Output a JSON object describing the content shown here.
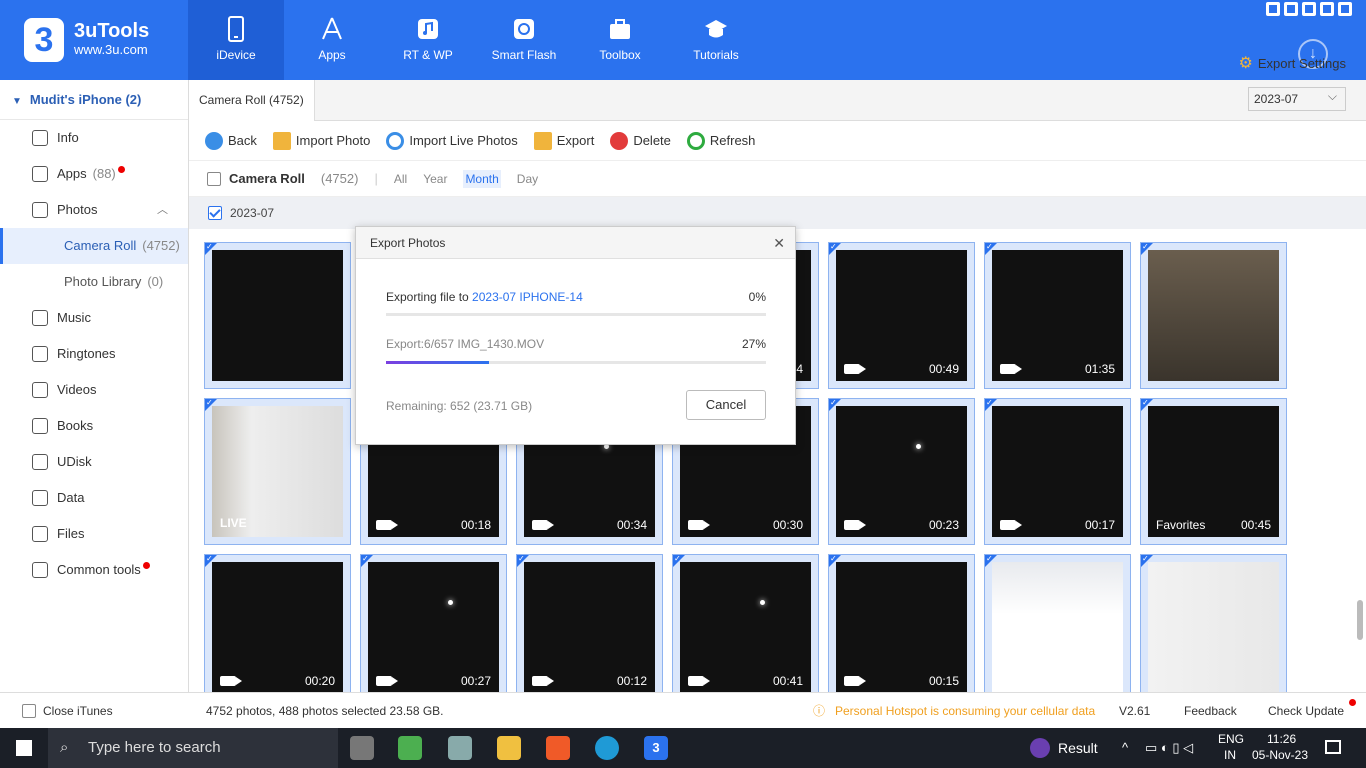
{
  "app": {
    "name": "3uTools",
    "url": "www.3u.com"
  },
  "nav": [
    {
      "label": "iDevice",
      "icon": "phone-icon",
      "active": true
    },
    {
      "label": "Apps",
      "icon": "apps-icon"
    },
    {
      "label": "RT & WP",
      "icon": "music-icon"
    },
    {
      "label": "Smart Flash",
      "icon": "flash-icon"
    },
    {
      "label": "Toolbox",
      "icon": "toolbox-icon"
    },
    {
      "label": "Tutorials",
      "icon": "graduation-cap-icon"
    }
  ],
  "sidebar": {
    "device": "Mudit's iPhone (2)",
    "items": [
      {
        "label": "Info",
        "icon": "info-icon"
      },
      {
        "label": "Apps",
        "count": "(88)",
        "icon": "apps-icon",
        "dot": true
      },
      {
        "label": "Photos",
        "icon": "photos-icon"
      },
      {
        "label": "Camera Roll",
        "count": "(4752)",
        "sub": true,
        "selected": true
      },
      {
        "label": "Photo Library",
        "count": "(0)",
        "sub": true
      },
      {
        "label": "Music",
        "icon": "music-icon"
      },
      {
        "label": "Ringtones",
        "icon": "bell-icon"
      },
      {
        "label": "Videos",
        "icon": "video-icon"
      },
      {
        "label": "Books",
        "icon": "book-icon"
      },
      {
        "label": "UDisk",
        "icon": "udisk-icon"
      },
      {
        "label": "Data",
        "icon": "folder-icon"
      },
      {
        "label": "Files",
        "icon": "file-icon"
      },
      {
        "label": "Common tools",
        "icon": "grid-icon",
        "dot": true
      }
    ]
  },
  "tab": "Camera Roll (4752)",
  "toolbar": {
    "back": "Back",
    "import_photo": "Import Photo",
    "import_live": "Import Live Photos",
    "export": "Export",
    "delete": "Delete",
    "refresh": "Refresh",
    "export_settings": "Export Settings"
  },
  "filter": {
    "label": "Camera Roll",
    "count": "(4752)",
    "options": [
      "All",
      "Year",
      "Month",
      "Day"
    ],
    "active": "Month",
    "date": "2023-07"
  },
  "group": "2023-07",
  "photos": [
    {
      "kind": "doc"
    },
    {
      "kind": "hidden"
    },
    {
      "kind": "hidden"
    },
    {
      "kind": "video",
      "duration": "14",
      "style": "hidden"
    },
    {
      "kind": "video",
      "duration": "00:49",
      "style": "sky"
    },
    {
      "kind": "video",
      "duration": "01:35",
      "style": "sky"
    },
    {
      "kind": "quote"
    },
    {
      "kind": "live",
      "label": "LIVE"
    },
    {
      "kind": "video",
      "duration": "00:18",
      "style": "dark"
    },
    {
      "kind": "video",
      "duration": "00:34",
      "style": "dark"
    },
    {
      "kind": "video",
      "duration": "00:30",
      "style": "dark"
    },
    {
      "kind": "video",
      "duration": "00:23",
      "style": "dark"
    },
    {
      "kind": "video",
      "duration": "00:17",
      "style": "dark"
    },
    {
      "kind": "fav",
      "label": "Favorites",
      "duration": "00:45"
    },
    {
      "kind": "video",
      "duration": "00:20",
      "style": "dark"
    },
    {
      "kind": "video",
      "duration": "00:27",
      "style": "dark"
    },
    {
      "kind": "video",
      "duration": "00:12",
      "style": "dark"
    },
    {
      "kind": "video",
      "duration": "00:41",
      "style": "dark"
    },
    {
      "kind": "video",
      "duration": "00:15",
      "style": "dark"
    },
    {
      "kind": "shop"
    },
    {
      "kind": "person"
    }
  ],
  "dialog": {
    "title": "Export Photos",
    "exporting_prefix": "Exporting file to ",
    "exporting_target": "2023-07 IPHONE-14",
    "overall_percent": "0%",
    "overall_fraction": 0.0,
    "file_line": "Export:6/657 IMG_1430.MOV",
    "file_percent": "27%",
    "file_fraction": 0.27,
    "remaining": "Remaining: 652 (23.71 GB)",
    "cancel": "Cancel"
  },
  "status": {
    "close_itunes": "Close iTunes",
    "summary": "4752 photos, 488 photos selected 23.58 GB.",
    "warning": "Personal Hotspot is consuming your cellular data",
    "version": "V2.61",
    "feedback": "Feedback",
    "check_update": "Check Update"
  },
  "taskbar": {
    "search": "Type here to search",
    "result": "Result",
    "lang1": "ENG",
    "lang2": "IN",
    "time": "11:26",
    "date": "05-Nov-23"
  }
}
